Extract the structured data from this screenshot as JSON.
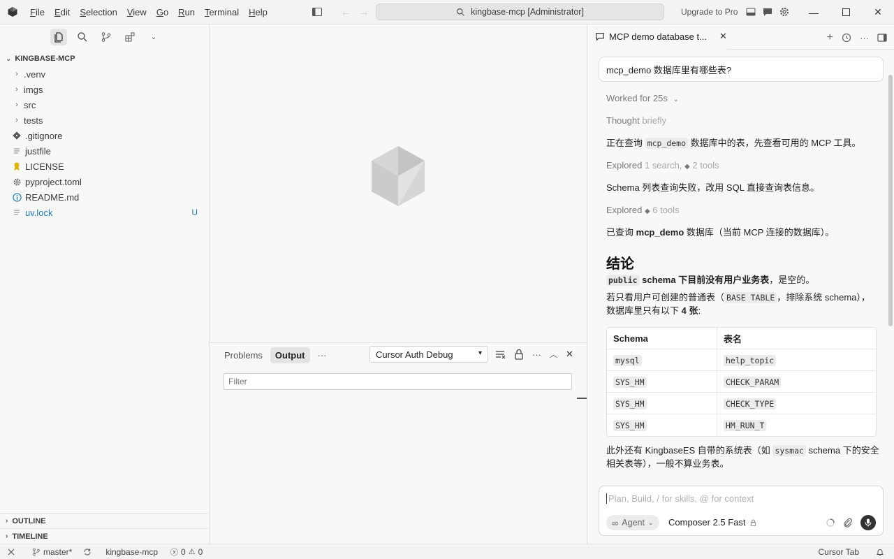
{
  "titlebar": {
    "menu": [
      "File",
      "Edit",
      "Selection",
      "View",
      "Go",
      "Run",
      "Terminal",
      "Help"
    ],
    "menu_mnemonics": [
      "F",
      "E",
      "S",
      "V",
      "G",
      "R",
      "T",
      "H"
    ],
    "search_text": "kingbase-mcp [Administrator]",
    "upgrade_label": "Upgrade to Pro"
  },
  "explorer": {
    "root": "KINGBASE-MCP",
    "items": [
      {
        "name": ".venv",
        "type": "folder"
      },
      {
        "name": "imgs",
        "type": "folder"
      },
      {
        "name": "src",
        "type": "folder"
      },
      {
        "name": "tests",
        "type": "folder"
      },
      {
        "name": ".gitignore",
        "type": "file",
        "icon": "git-icon"
      },
      {
        "name": "justfile",
        "type": "file",
        "icon": "lines-icon"
      },
      {
        "name": "LICENSE",
        "type": "file",
        "icon": "license-icon"
      },
      {
        "name": "pyproject.toml",
        "type": "file",
        "icon": "gear-icon"
      },
      {
        "name": "README.md",
        "type": "file",
        "icon": "info-icon"
      },
      {
        "name": "uv.lock",
        "type": "file",
        "icon": "lines-icon",
        "badge": "U"
      }
    ],
    "outline_label": "OUTLINE",
    "timeline_label": "TIMELINE"
  },
  "panel": {
    "tabs": [
      "Problems",
      "Output"
    ],
    "active_tab": "Output",
    "more": "···",
    "output_channel": "Cursor Auth Debug",
    "filter_placeholder": "Filter"
  },
  "chat": {
    "tab_title": "MCP demo database t...",
    "user_message": "mcp_demo 数据库里有哪些表?",
    "worked_for": "Worked for 25s",
    "thought": {
      "prefix": "Thought",
      "suffix": "briefly"
    },
    "line1": {
      "a": "正在查询",
      "code": "mcp_demo",
      "b": "数据库中的表，先查看可用的 MCP 工具。"
    },
    "explored1": {
      "prefix": "Explored",
      "a": "1 search,",
      "b": "2 tools"
    },
    "line2": "Schema 列表查询失败，改用 SQL 直接查询表信息。",
    "explored2": {
      "prefix": "Explored",
      "b": "6 tools"
    },
    "line3": {
      "a": "已查询",
      "bold": "mcp_demo",
      "b": "数据库（当前 MCP 连接的数据库）。"
    },
    "conclusion": "结论",
    "line4": {
      "code": "public",
      "bold": "schema 下目前没有用户业务表",
      "b": "，是空的。"
    },
    "line5": {
      "a": "若只看用户可创建的普通表（",
      "code": "BASE TABLE",
      "b": "，排除系统 schema），"
    },
    "line6": {
      "a": "数据库里只有以下",
      "bold": "4 张",
      "b": ":"
    },
    "table": {
      "headers": [
        "Schema",
        "表名"
      ],
      "rows": [
        [
          "mysql",
          "help_topic"
        ],
        [
          "SYS_HM",
          "CHECK_PARAM"
        ],
        [
          "SYS_HM",
          "CHECK_TYPE"
        ],
        [
          "SYS_HM",
          "HM_RUN_T"
        ]
      ]
    },
    "line7": {
      "a": "此外还有 KingbaseES 自带的系统表（如",
      "code": "sysmac",
      "b": "schema 下的安全"
    },
    "line8": "相关表等），一般不算业务表。",
    "composer_placeholder": "Plan, Build, / for skills, @ for context",
    "mode": "Agent",
    "model": "Composer 2.5 Fast"
  },
  "statusbar": {
    "branch": "master*",
    "project": "kingbase-mcp",
    "errors": "0",
    "warnings": "0",
    "right_label": "Cursor Tab"
  }
}
